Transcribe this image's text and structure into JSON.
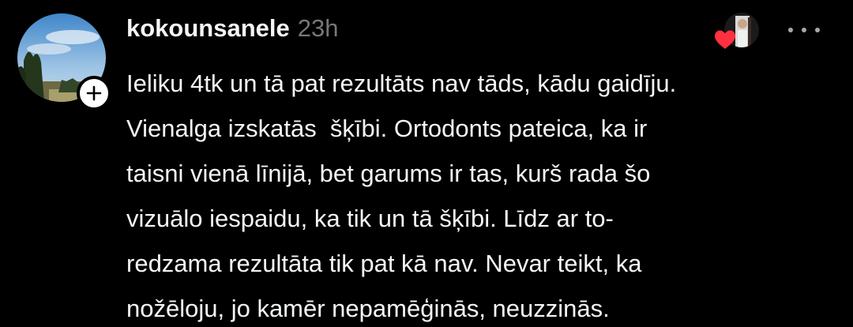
{
  "comment": {
    "username": "kokounsanele",
    "timestamp": "23h",
    "text": "Ieliku 4tk un tā pat rezultāts nav tāds, kādu gaidīju.\nVienalga izskatās  šķībi. Ortodonts pateica, ka ir\ntaisni vienā līnijā, bet garums ir tas, kurš rada šo\nvizuālo iespaidu, ka tik un tā šķībi. Līdz ar to-\nredzama rezultāta tik pat kā nav. Nevar teikt, ka\nnožēloju, jo kamēr nepamēģinās, neuzzinās."
  },
  "icons": {
    "avatar": "profile-photo-landscape",
    "follow": "plus-icon",
    "creator_like": "heart-icon",
    "more": "more-horizontal-icon"
  },
  "colors": {
    "background": "#000000",
    "text": "#f3f5f7",
    "timestamp": "#777777",
    "heart": "#ff3040"
  }
}
